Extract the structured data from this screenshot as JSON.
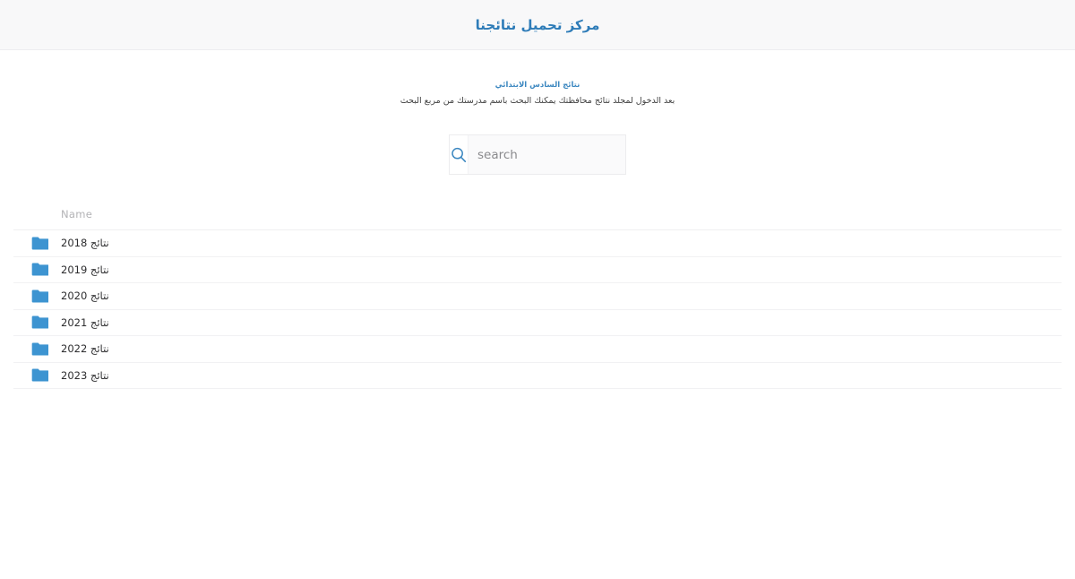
{
  "header": {
    "title": "مركز تحميل نتائجنا",
    "accent_color": "#2e7cb8",
    "background_color": "#f8f8f9"
  },
  "intro": {
    "line1": "نتائج السادس الابتدائي",
    "line2": "بعد الدخول لمجلد نتائج محافظتك يمكنك البحث باسم مدرستك من مربع البحث",
    "line1_color": "#3b87c0"
  },
  "search": {
    "icon": "search-icon",
    "placeholder": "search",
    "value": "",
    "icon_color": "#3b87c0"
  },
  "file_list": {
    "columns": [
      "Name"
    ],
    "folder_icon_color": "#3d94d1",
    "rows": [
      {
        "icon": "folder-icon",
        "name": "نتائج 2018"
      },
      {
        "icon": "folder-icon",
        "name": "نتائج 2019"
      },
      {
        "icon": "folder-icon",
        "name": "نتائج 2020"
      },
      {
        "icon": "folder-icon",
        "name": "نتائج 2021"
      },
      {
        "icon": "folder-icon",
        "name": "نتائج 2022"
      },
      {
        "icon": "folder-icon",
        "name": "نتائج 2023"
      }
    ]
  }
}
